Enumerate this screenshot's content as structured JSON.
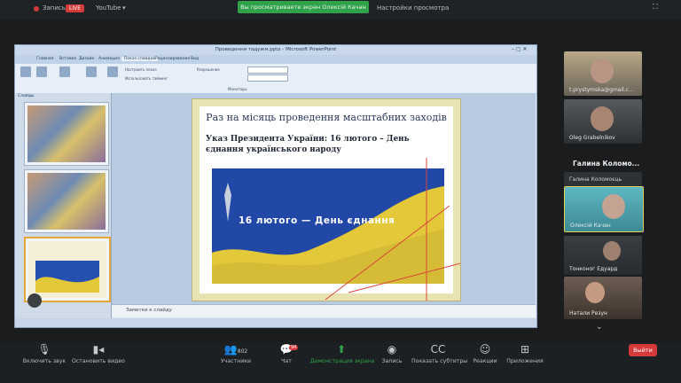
{
  "topbar": {
    "record_label": "Запись",
    "live_label": "LIVE",
    "youtube_label": "YouTube",
    "share_banner": "Вы просматриваете экран Олексій Качан",
    "view_settings": "Настройки просмотра"
  },
  "ppt": {
    "window_title": "Проведення тадужм.pptx - Microsoft PowerPoint",
    "tabs": [
      "Главная",
      "Вставка",
      "Дизайн",
      "Анимация",
      "Показ слайдов",
      "Рецензирование",
      "Вид"
    ],
    "ribbon_labels": [
      "Настроить показ",
      "Использовать тайминг",
      "Разрешение",
      "Мониторы"
    ],
    "notes_placeholder": "Заметки к слайду",
    "thumb_tab": "Слайды"
  },
  "slide": {
    "title": "Раз на місяць проведення масштабних заходів",
    "subtitle": "Указ Президента України: 16 лютого – День єднання українського народу",
    "flag_caption": "16 лютого — День єднання"
  },
  "participants": [
    {
      "name": "t.prystymska@gmail.c..."
    },
    {
      "name": "Oleg Grabelnikov"
    },
    {
      "name": "Галина Коломоєць"
    },
    {
      "name": "Олексій Качан"
    },
    {
      "name": "Тонконог Едуард"
    },
    {
      "name": "Натали Резун"
    }
  ],
  "gallery_name": "Галина Коломо...",
  "toolbar": {
    "mute": "Включить звук",
    "video": "Остановить видео",
    "participants_count": "802",
    "participants": "Участники",
    "chat": "Чат",
    "chat_badge": "94",
    "share": "Демонстрация экрана",
    "record": "Запись",
    "captions": "Показать субтитры",
    "reactions": "Реакции",
    "apps": "Приложения",
    "end": "Выйти"
  },
  "colors": {
    "share_green": "#2fa24a",
    "live_red": "#d43a3a",
    "flag_blue": "#1f47a6",
    "flag_yellow": "#e3c93a"
  }
}
